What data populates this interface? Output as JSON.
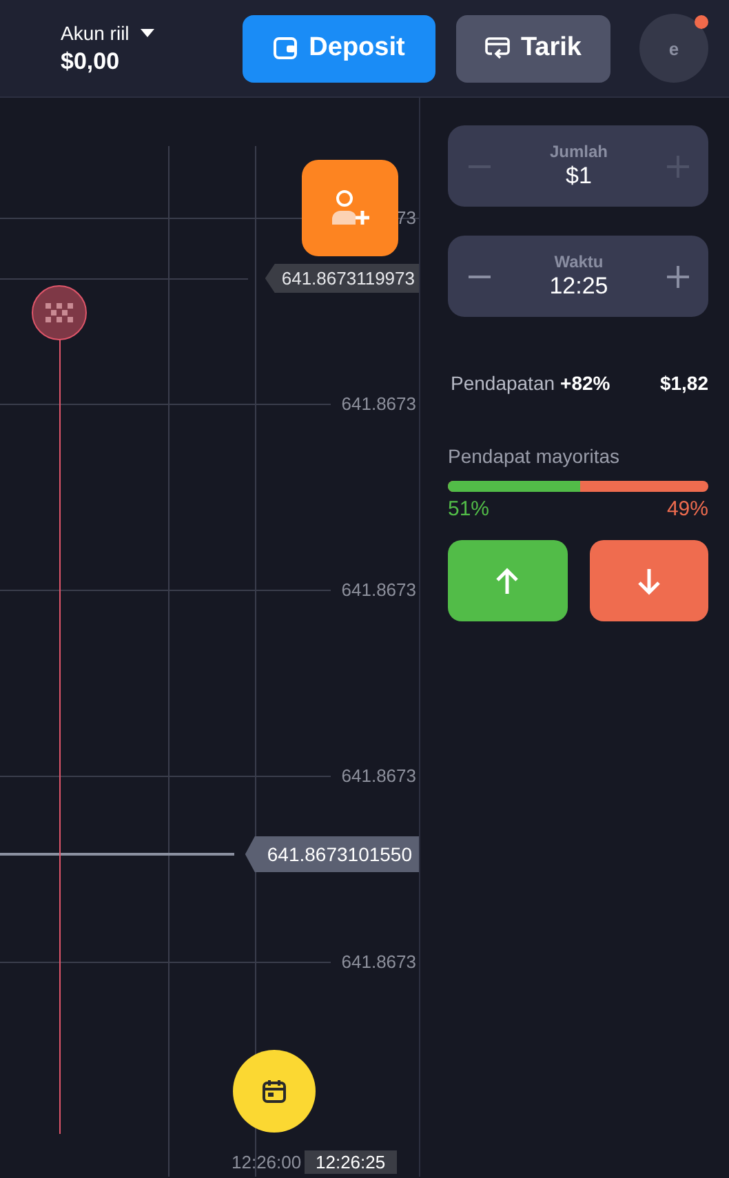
{
  "header": {
    "account": {
      "label": "Akun riil",
      "balance": "$0,00"
    },
    "buttons": [
      {
        "kind": "deposit",
        "label": "Deposit"
      },
      {
        "kind": "withdraw",
        "label": "Tarik"
      }
    ],
    "avatar": {
      "initial": "e",
      "notification": true
    }
  },
  "chart": {
    "price_labels": [
      {
        "text": "73"
      },
      {
        "text": "641.8673"
      },
      {
        "text": "641.8673"
      },
      {
        "text": "641.8673"
      },
      {
        "text": "641.8673"
      }
    ],
    "marker_tag": "641.8673119973",
    "current_price": "641.8673101550",
    "time_labels": [
      {
        "text": "12:26:00",
        "kind": "tick"
      },
      {
        "text": "12:26:25",
        "kind": "current"
      }
    ]
  },
  "trade_panel": {
    "steppers": [
      {
        "label": "Jumlah",
        "value": "$1",
        "disabled": true
      },
      {
        "label": "Waktu",
        "value": "12:25",
        "disabled": false
      }
    ],
    "payout": {
      "label": "Pendapatan",
      "percent": "+82%",
      "amount": "$1,82"
    },
    "sentiment": {
      "title": "Pendapat mayoritas",
      "level": 0.51,
      "up": "51%",
      "down": "49%"
    },
    "actions": [
      {
        "kind": "up"
      },
      {
        "kind": "down"
      }
    ]
  }
}
